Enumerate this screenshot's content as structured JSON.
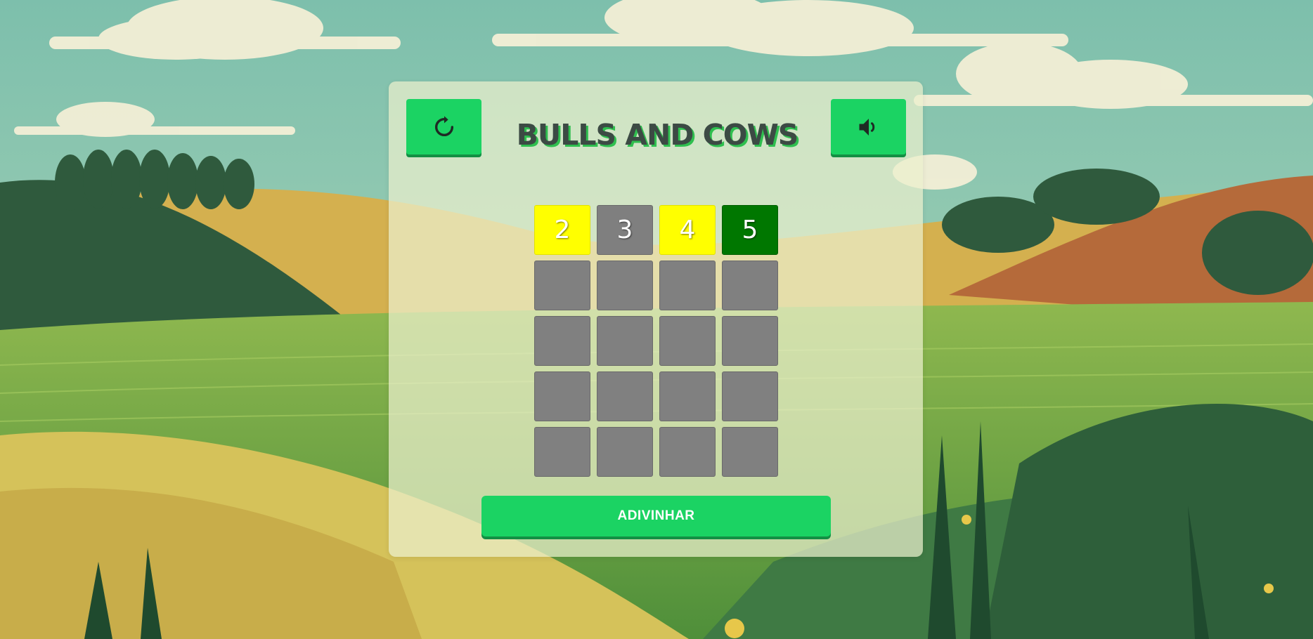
{
  "game": {
    "title": "BULLS AND COWS",
    "guess_button_label": "ADIVINHAR"
  },
  "toolbar": {
    "restart_icon": "restart-icon",
    "sound_icon": "speaker-icon"
  },
  "board": {
    "rows": [
      [
        {
          "value": "2",
          "state": "yellow"
        },
        {
          "value": "3",
          "state": "gray"
        },
        {
          "value": "4",
          "state": "yellow"
        },
        {
          "value": "5",
          "state": "green"
        }
      ],
      [
        {
          "value": "",
          "state": "empty"
        },
        {
          "value": "",
          "state": "empty"
        },
        {
          "value": "",
          "state": "empty"
        },
        {
          "value": "",
          "state": "empty"
        }
      ],
      [
        {
          "value": "",
          "state": "empty"
        },
        {
          "value": "",
          "state": "empty"
        },
        {
          "value": "",
          "state": "empty"
        },
        {
          "value": "",
          "state": "empty"
        }
      ],
      [
        {
          "value": "",
          "state": "empty"
        },
        {
          "value": "",
          "state": "empty"
        },
        {
          "value": "",
          "state": "empty"
        },
        {
          "value": "",
          "state": "empty"
        }
      ],
      [
        {
          "value": "",
          "state": "empty"
        },
        {
          "value": "",
          "state": "empty"
        },
        {
          "value": "",
          "state": "empty"
        },
        {
          "value": "",
          "state": "empty"
        }
      ]
    ]
  },
  "colors": {
    "accent": "#1bd363",
    "accent_shadow": "#138f44",
    "tile_gray": "#808080",
    "tile_yellow": "#ffff00",
    "tile_green": "#007700",
    "title_text": "#3c4a44",
    "title_shadow": "#2fbf4f"
  }
}
